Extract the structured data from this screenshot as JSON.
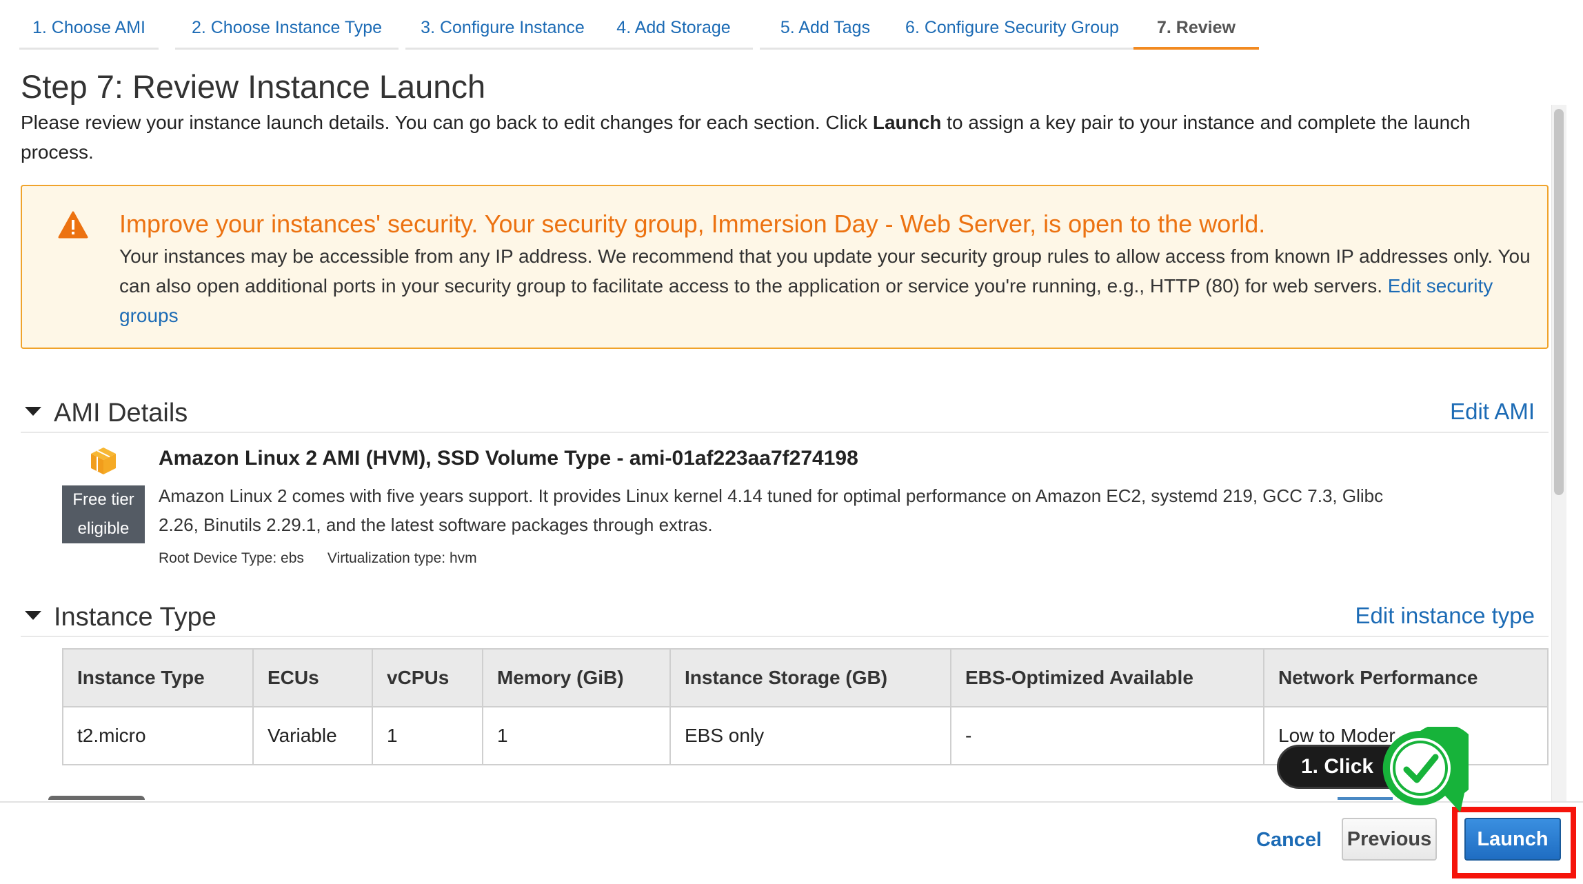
{
  "tabs": [
    {
      "label": "1. Choose AMI"
    },
    {
      "label": "2. Choose Instance Type"
    },
    {
      "label": "3. Configure Instance"
    },
    {
      "label": "4. Add Storage"
    },
    {
      "label": "5. Add Tags"
    },
    {
      "label": "6. Configure Security Group"
    },
    {
      "label": "7. Review",
      "active": true
    }
  ],
  "page": {
    "title": "Step 7: Review Instance Launch",
    "intro_before": "Please review your instance launch details. You can go back to edit changes for each section. Click ",
    "intro_bold": "Launch",
    "intro_after": " to assign a key pair to your instance and complete the launch process."
  },
  "warning": {
    "icon": "warning-triangle-icon",
    "title": "Improve your instances' security. Your security group, Immersion Day - Web Server, is open to the world.",
    "line1": "Your instances may be accessible from any IP address. We recommend that you update your security group rules to allow access from known IP addresses only.",
    "line2": "You can also open additional ports in your security group to facilitate access to the application or service you're running, e.g., HTTP (80) for web servers. ",
    "link": "Edit security groups"
  },
  "ami_section": {
    "title": "AMI Details",
    "edit": "Edit AMI",
    "icon": "ami-cube-icon",
    "free_tier_line1": "Free tier",
    "free_tier_line2": "eligible",
    "name": "Amazon Linux 2 AMI (HVM), SSD Volume Type - ami-01af223aa7f274198",
    "description": "Amazon Linux 2 comes with five years support. It provides Linux kernel 4.14 tuned for optimal performance on Amazon EC2, systemd 219, GCC 7.3, Glibc 2.26, Binutils 2.29.1, and the latest software packages through extras.",
    "root_device": "Root Device Type: ebs",
    "virtualization": "Virtualization type: hvm"
  },
  "instance_section": {
    "title": "Instance Type",
    "edit": "Edit instance type",
    "columns": [
      "Instance Type",
      "ECUs",
      "vCPUs",
      "Memory (GiB)",
      "Instance Storage (GB)",
      "EBS-Optimized Available",
      "Network Performance"
    ],
    "rows": [
      [
        "t2.micro",
        "Variable",
        "1",
        "1",
        "EBS only",
        "-",
        "Low to Moder"
      ]
    ]
  },
  "footer": {
    "cancel": "Cancel",
    "previous": "Previous",
    "launch": "Launch"
  },
  "annotation": {
    "bubble": "1. Click",
    "badge_icon": "checkmark-icon",
    "highlight_color": "#f5140b",
    "badge_color": "#17b33a"
  },
  "colors": {
    "link": "#1c6bb5",
    "active_tab_underline": "#f28a21",
    "warning_title": "#ec7211",
    "warning_border": "#f0a32b",
    "warning_bg": "#fef7e7",
    "launch_button": "#1f6dc2"
  }
}
